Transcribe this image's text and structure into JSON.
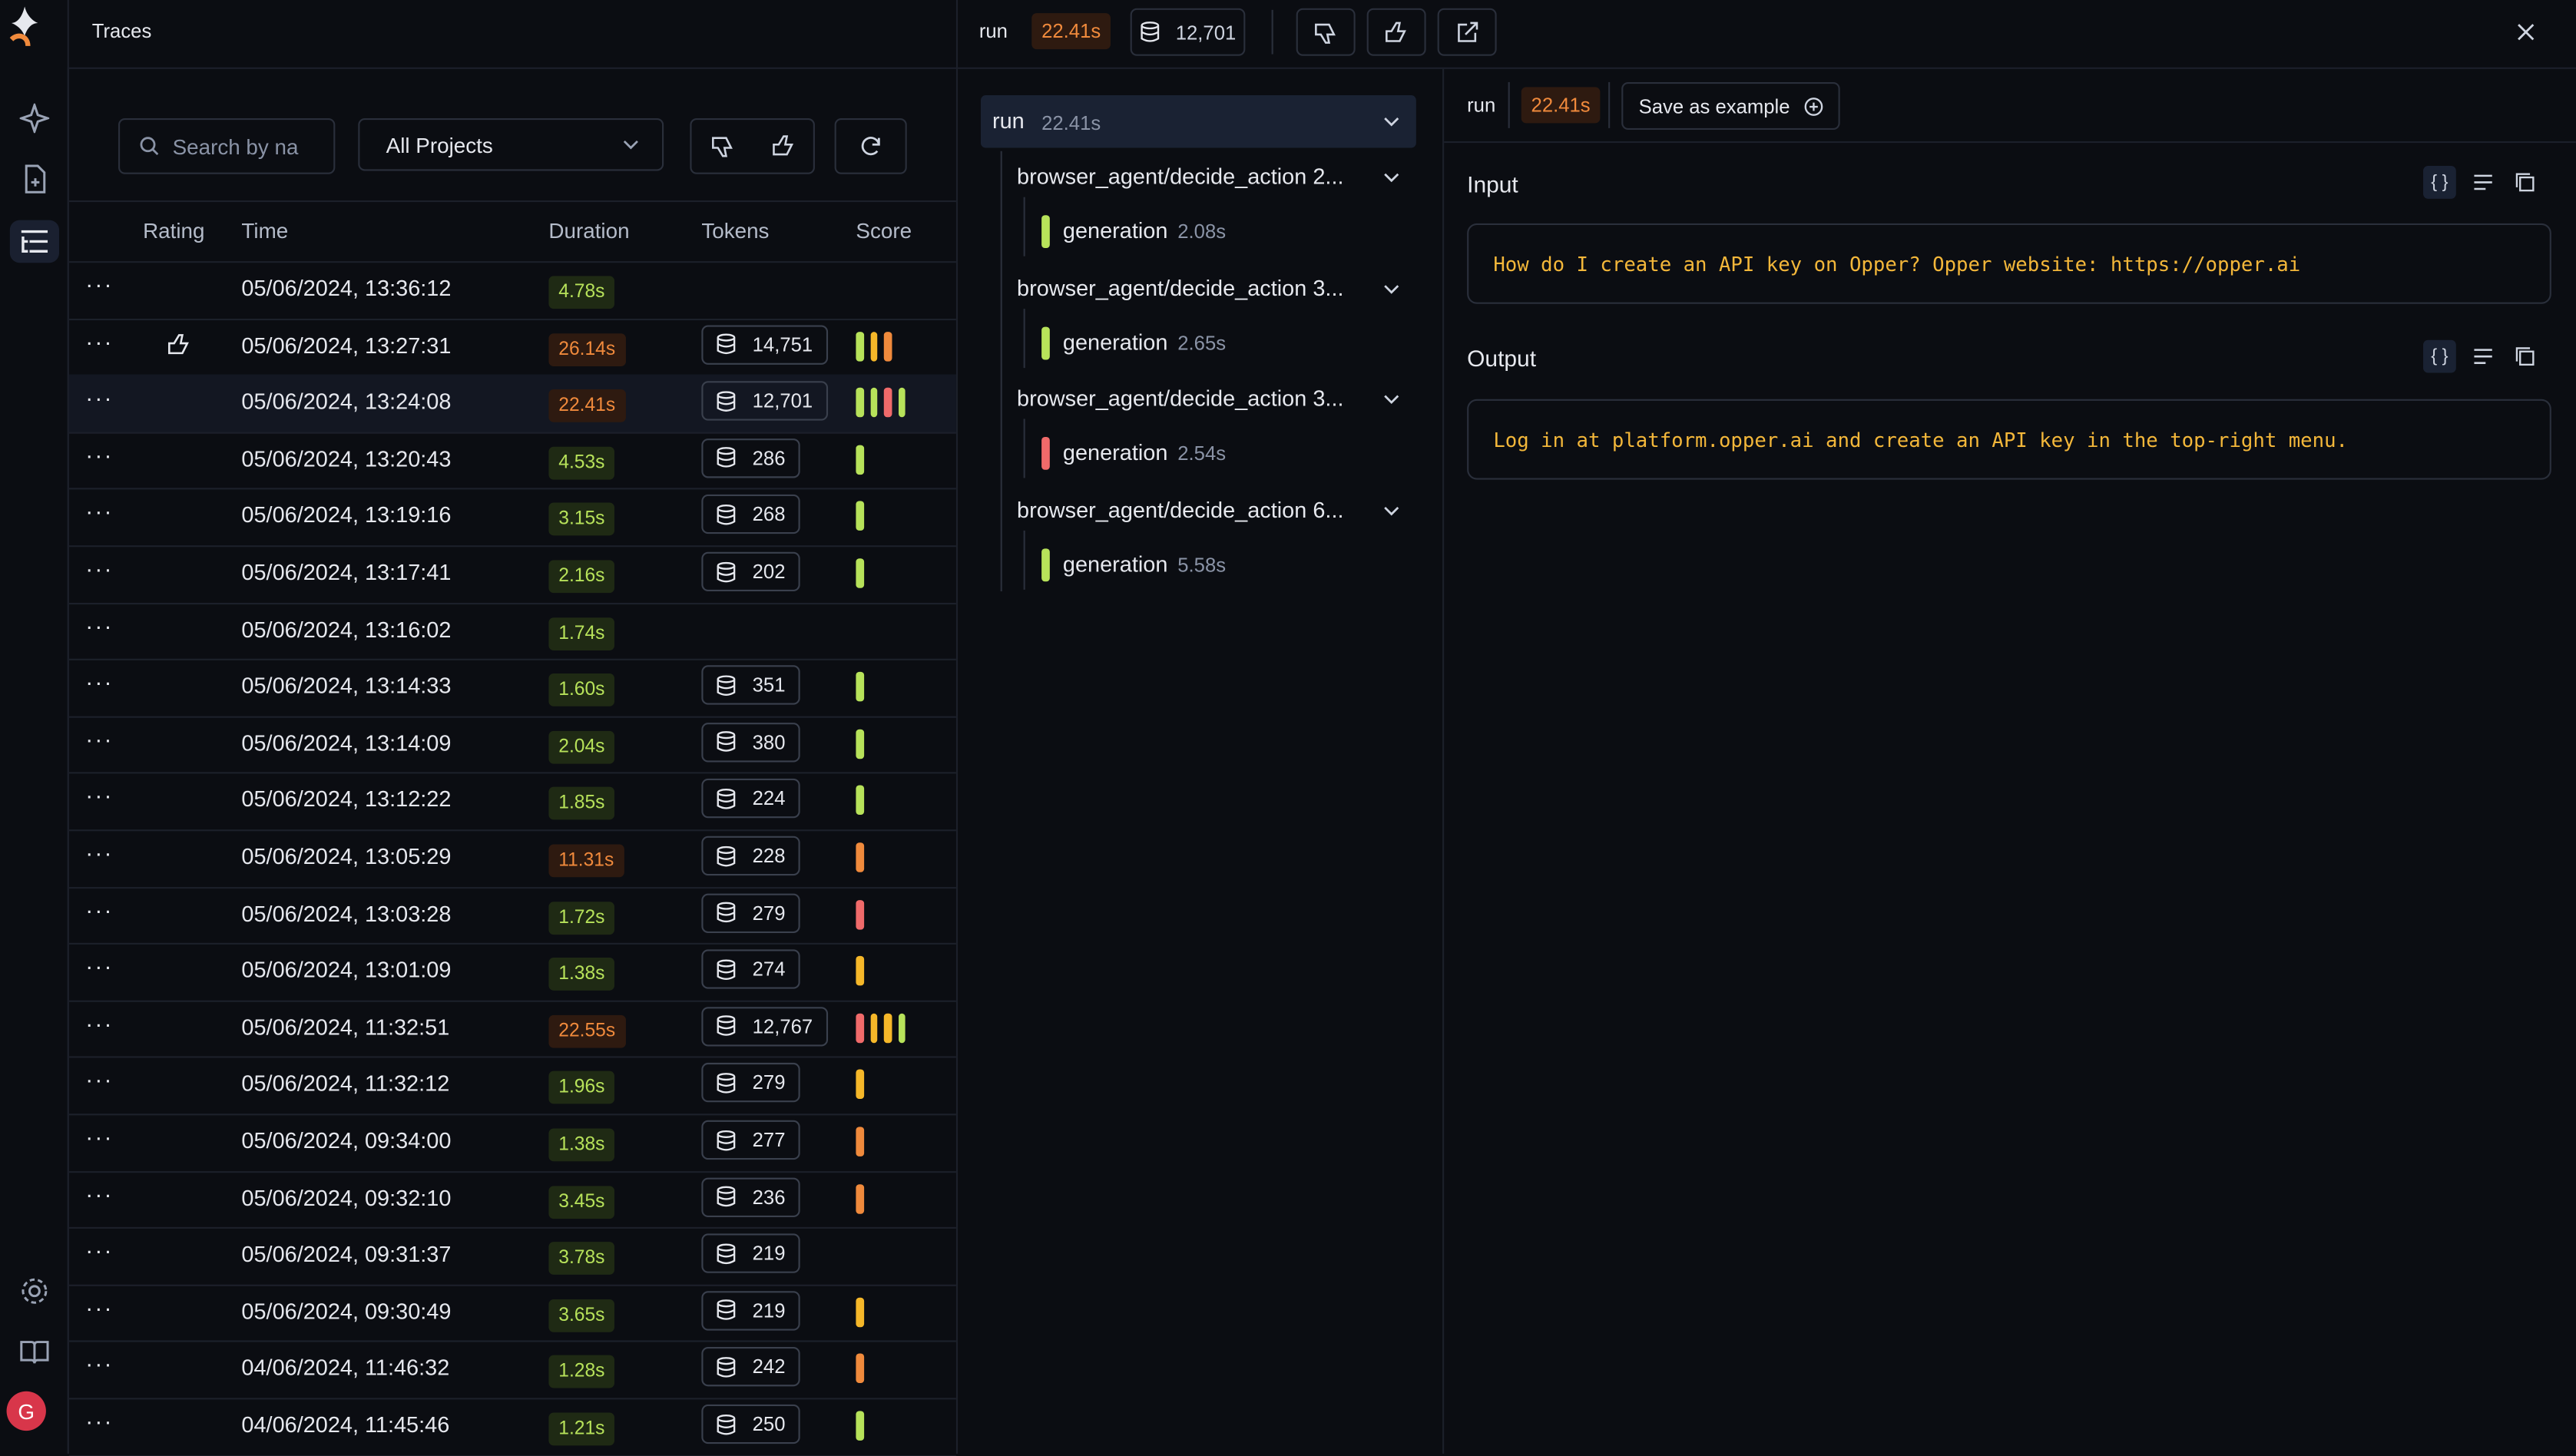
{
  "header": {
    "title": "Traces"
  },
  "filters": {
    "search_placeholder": "Search by na",
    "project_select": "All Projects"
  },
  "table": {
    "columns": [
      "Rating",
      "Time",
      "Duration",
      "Tokens",
      "Score"
    ],
    "rows": [
      {
        "time": "05/06/2024, 13:36:12",
        "duration": "4.78s",
        "dur_color": "g",
        "tokens": "",
        "rating": "",
        "scores": []
      },
      {
        "time": "05/06/2024, 13:27:31",
        "duration": "26.14s",
        "dur_color": "o",
        "tokens": "14,751",
        "rating": "thumbs-up",
        "scores": [
          "#b7e25a",
          "#f5b729",
          "#f08a3c"
        ]
      },
      {
        "time": "05/06/2024, 13:24:08",
        "duration": "22.41s",
        "dur_color": "o",
        "tokens": "12,701",
        "rating": "",
        "scores": [
          "#b7e25a",
          "#b7e25a",
          "#f06a6a",
          "#b7e25a"
        ],
        "selected": true
      },
      {
        "time": "05/06/2024, 13:20:43",
        "duration": "4.53s",
        "dur_color": "g",
        "tokens": "286",
        "rating": "",
        "scores": [
          "#b7e25a"
        ]
      },
      {
        "time": "05/06/2024, 13:19:16",
        "duration": "3.15s",
        "dur_color": "g",
        "tokens": "268",
        "rating": "",
        "scores": [
          "#b7e25a"
        ]
      },
      {
        "time": "05/06/2024, 13:17:41",
        "duration": "2.16s",
        "dur_color": "g",
        "tokens": "202",
        "rating": "",
        "scores": [
          "#b7e25a"
        ]
      },
      {
        "time": "05/06/2024, 13:16:02",
        "duration": "1.74s",
        "dur_color": "g",
        "tokens": "",
        "rating": "",
        "scores": []
      },
      {
        "time": "05/06/2024, 13:14:33",
        "duration": "1.60s",
        "dur_color": "g",
        "tokens": "351",
        "rating": "",
        "scores": [
          "#b7e25a"
        ]
      },
      {
        "time": "05/06/2024, 13:14:09",
        "duration": "2.04s",
        "dur_color": "g",
        "tokens": "380",
        "rating": "",
        "scores": [
          "#b7e25a"
        ]
      },
      {
        "time": "05/06/2024, 13:12:22",
        "duration": "1.85s",
        "dur_color": "g",
        "tokens": "224",
        "rating": "",
        "scores": [
          "#b7e25a"
        ]
      },
      {
        "time": "05/06/2024, 13:05:29",
        "duration": "11.31s",
        "dur_color": "o",
        "tokens": "228",
        "rating": "",
        "scores": [
          "#f08a3c"
        ]
      },
      {
        "time": "05/06/2024, 13:03:28",
        "duration": "1.72s",
        "dur_color": "g",
        "tokens": "279",
        "rating": "",
        "scores": [
          "#f06a6a"
        ]
      },
      {
        "time": "05/06/2024, 13:01:09",
        "duration": "1.38s",
        "dur_color": "g",
        "tokens": "274",
        "rating": "",
        "scores": [
          "#f5b729"
        ]
      },
      {
        "time": "05/06/2024, 11:32:51",
        "duration": "22.55s",
        "dur_color": "o",
        "tokens": "12,767",
        "rating": "",
        "scores": [
          "#f06a6a",
          "#f5b729",
          "#f5b729",
          "#b7e25a"
        ]
      },
      {
        "time": "05/06/2024, 11:32:12",
        "duration": "1.96s",
        "dur_color": "g",
        "tokens": "279",
        "rating": "",
        "scores": [
          "#f5b729"
        ]
      },
      {
        "time": "05/06/2024, 09:34:00",
        "duration": "1.38s",
        "dur_color": "g",
        "tokens": "277",
        "rating": "",
        "scores": [
          "#f08a3c"
        ]
      },
      {
        "time": "05/06/2024, 09:32:10",
        "duration": "3.45s",
        "dur_color": "g",
        "tokens": "236",
        "rating": "",
        "scores": [
          "#f08a3c"
        ]
      },
      {
        "time": "05/06/2024, 09:31:37",
        "duration": "3.78s",
        "dur_color": "g",
        "tokens": "219",
        "rating": "",
        "scores": []
      },
      {
        "time": "05/06/2024, 09:30:49",
        "duration": "3.65s",
        "dur_color": "g",
        "tokens": "219",
        "rating": "",
        "scores": [
          "#f5b729"
        ]
      },
      {
        "time": "04/06/2024, 11:46:32",
        "duration": "1.28s",
        "dur_color": "g",
        "tokens": "242",
        "rating": "",
        "scores": [
          "#f08a3c"
        ]
      },
      {
        "time": "04/06/2024, 11:45:46",
        "duration": "1.21s",
        "dur_color": "g",
        "tokens": "250",
        "rating": "",
        "scores": [
          "#b7e25a"
        ]
      }
    ]
  },
  "detail_header": {
    "run_label": "run",
    "duration": "22.41s",
    "tokens": "12,701"
  },
  "tree": {
    "run_label": "run",
    "run_duration": "22.41s",
    "nodes": [
      {
        "label": "browser_agent/decide_action",
        "suffix": "2...",
        "gen_label": "generation",
        "gen_duration": "2.08s",
        "color": "#b7e25a"
      },
      {
        "label": "browser_agent/decide_action",
        "suffix": "3...",
        "gen_label": "generation",
        "gen_duration": "2.65s",
        "color": "#b7e25a"
      },
      {
        "label": "browser_agent/decide_action",
        "suffix": "3...",
        "gen_label": "generation",
        "gen_duration": "2.54s",
        "color": "#f06a6a"
      },
      {
        "label": "browser_agent/decide_action",
        "suffix": "6...",
        "gen_label": "generation",
        "gen_duration": "5.58s",
        "color": "#b7e25a"
      }
    ]
  },
  "span": {
    "run_label": "run",
    "duration": "22.41s",
    "save_label": "Save as example",
    "input_title": "Input",
    "input_text": "How do I create an API key on Opper? Opper website: https://opper.ai",
    "output_title": "Output",
    "output_text": "Log in at platform.opper.ai and create an API key in the top-right menu.",
    "json_toggle": "{ }"
  },
  "user": {
    "avatar_initial": "G"
  },
  "colors": {
    "accent_green": "#b7e25a",
    "accent_orange": "#f08a3c",
    "accent_red": "#f06a6a",
    "accent_yellow": "#f5b729",
    "code_text": "#f3b73a"
  }
}
